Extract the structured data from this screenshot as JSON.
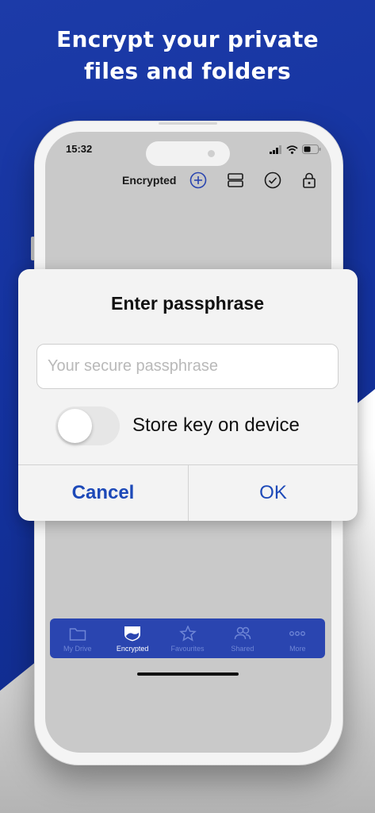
{
  "headline": {
    "line1": "Encrypt your private",
    "line2": "files and folders"
  },
  "status_bar": {
    "time": "15:32",
    "icons": [
      "signal-icon",
      "wifi-icon",
      "battery-icon"
    ]
  },
  "toolbar": {
    "title": "Encrypted",
    "icons": [
      "add-circle-icon",
      "list-view-icon",
      "select-check-icon",
      "lock-icon"
    ],
    "accent": "#2a45b0"
  },
  "dialog": {
    "title": "Enter passphrase",
    "input_placeholder": "Your secure passphrase",
    "input_value": "",
    "toggle_label": "Store key on device",
    "toggle_on": false,
    "cancel_label": "Cancel",
    "ok_label": "OK",
    "button_color": "#1d49b8"
  },
  "tabbar": {
    "background": "#2a45b0",
    "items": [
      {
        "label": "My Drive",
        "icon": "folder-icon",
        "active": false
      },
      {
        "label": "Encrypted",
        "icon": "shield-icon",
        "active": true
      },
      {
        "label": "Favourites",
        "icon": "star-icon",
        "active": false
      },
      {
        "label": "Shared",
        "icon": "people-icon",
        "active": false
      },
      {
        "label": "More",
        "icon": "more-dots-icon",
        "active": false
      }
    ]
  }
}
